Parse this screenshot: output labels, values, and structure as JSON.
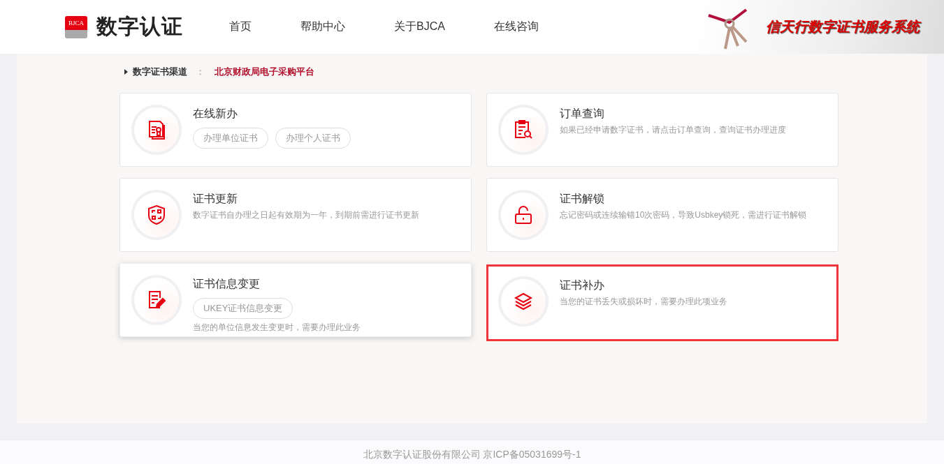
{
  "header": {
    "logo_badge": "BJCA",
    "logo_text": "数字认证",
    "nav": [
      {
        "label": "首页",
        "selected": false
      },
      {
        "label": "帮助中心",
        "selected": false
      },
      {
        "label": "关于BJCA",
        "selected": false
      },
      {
        "label": "在线咨询",
        "selected": false
      }
    ],
    "banner_title": "信天行数字证书服务系统"
  },
  "breadcrumb": {
    "label": "数字证书渠道",
    "separator": "：",
    "value": "北京财政局电子采购平台"
  },
  "cards": [
    {
      "title": "在线新办",
      "tags": [
        "办理单位证书",
        "办理个人证书"
      ],
      "hovered": false,
      "selected": false
    },
    {
      "title": "订单查询",
      "description": "如果已经申请数字证书，请点击订单查询，查询证书办理进度",
      "hovered": false,
      "selected": false
    },
    {
      "title": "证书更新",
      "description": "数字证书自办理之日起有效期为一年，到期前需进行证书更新",
      "hovered": false,
      "selected": false
    },
    {
      "title": "证书解锁",
      "description": "忘记密码或连续输错10次密码，导致Usbkey锁死，需进行证书解锁",
      "hovered": false,
      "selected": false
    },
    {
      "title": "证书信息变更",
      "tags": [
        "UKEY证书信息变更"
      ],
      "description": "当您的单位信息发生变更时，需要办理此业务",
      "hovered": true,
      "selected": false
    },
    {
      "title": "证书补办",
      "description": "当您的证书丢失或损坏时，需要办理此项业务",
      "hovered": false,
      "selected": true
    }
  ],
  "footer": "北京数字认证股份有限公司 京ICP备05031699号-1"
}
